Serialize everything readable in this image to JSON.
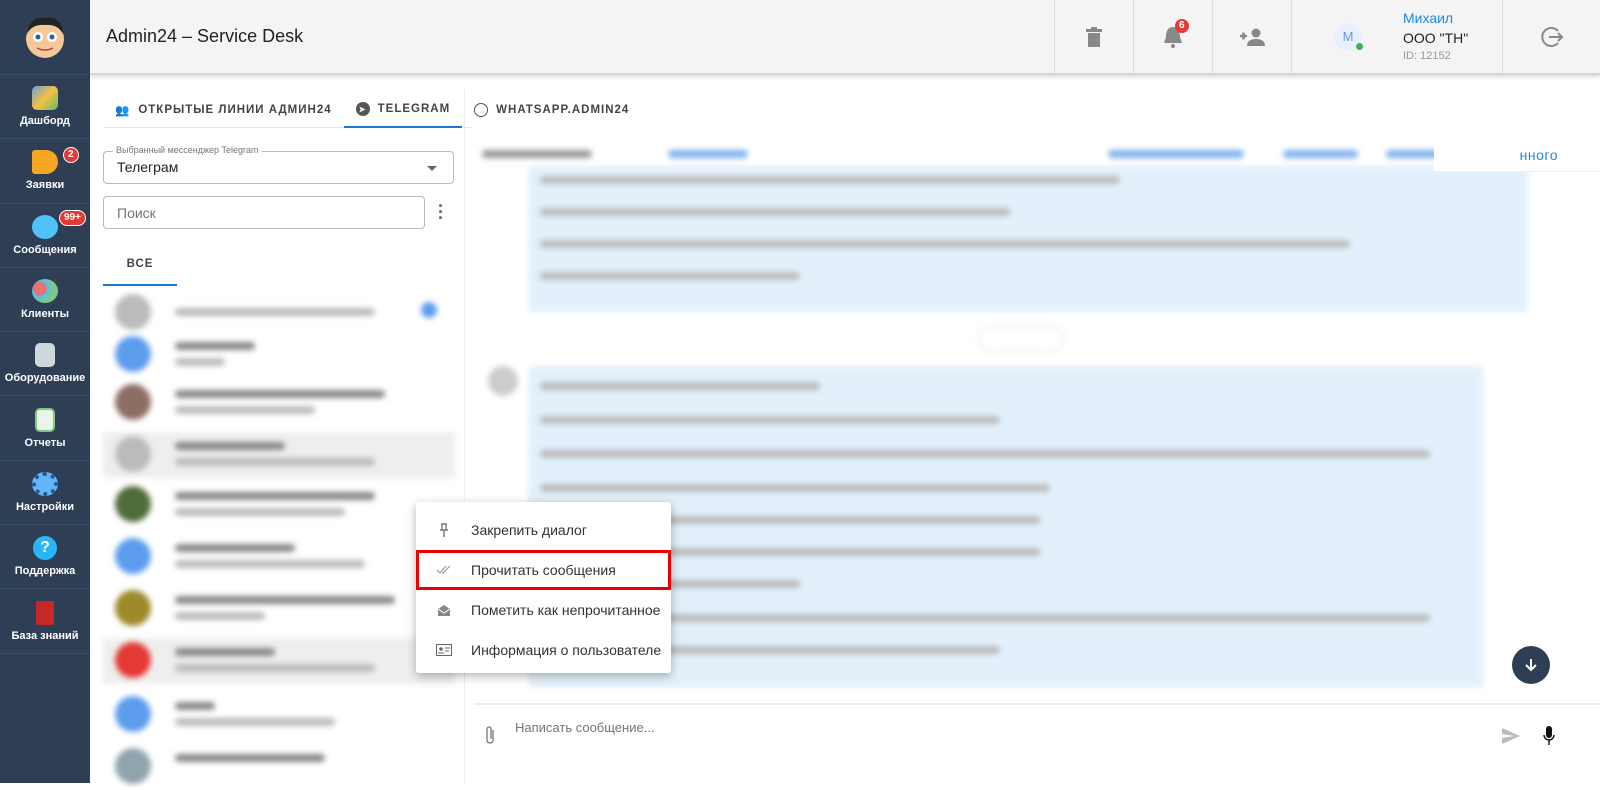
{
  "app": {
    "title": "Admin24 – Service Desk"
  },
  "sidebar": {
    "items": [
      {
        "label": "Дашборд",
        "color": "#6a9fd8"
      },
      {
        "label": "Заявки",
        "badge": "2",
        "color": "#f5a623"
      },
      {
        "label": "Сообщения",
        "badge": "99+",
        "color": "#4fc3f7"
      },
      {
        "label": "Клиенты",
        "color": "#e57373"
      },
      {
        "label": "Оборудование",
        "color": "#90caf9"
      },
      {
        "label": "Отчеты",
        "color": "#81c784"
      },
      {
        "label": "Настройки",
        "color": "#64b5f6"
      },
      {
        "label": "Поддержка",
        "color": "#29b6f6"
      },
      {
        "label": "База знаний",
        "color": "#c62828"
      }
    ]
  },
  "header": {
    "notifications_count": "6",
    "user": {
      "avatar_letter": "M",
      "name": "Михаил",
      "company": "ООО \"ТН\"",
      "id": "ID: 12152"
    }
  },
  "tabs": [
    {
      "label": "ОТКРЫТЫЕ ЛИНИИ АДМИН24"
    },
    {
      "label": "TELEGRAM",
      "active": true
    },
    {
      "label": "WHATSAPP.ADMIN24"
    }
  ],
  "messenger_select": {
    "legend": "Выбранный мессенджер Telegram",
    "value": "Телеграм"
  },
  "search": {
    "placeholder": "Поиск"
  },
  "filter_tab": "ВСЕ",
  "chat_header": {
    "partial_action": "нного"
  },
  "context_menu": [
    {
      "label": "Закрепить диалог",
      "icon": "pin-icon"
    },
    {
      "label": "Прочитать сообщения",
      "icon": "double-check-icon",
      "highlighted": true
    },
    {
      "label": "Пометить как непрочитанное",
      "icon": "open-envelope-icon"
    },
    {
      "label": "Информация о пользователе",
      "icon": "id-card-icon"
    }
  ],
  "composer": {
    "placeholder": "Написать сообщение..."
  }
}
